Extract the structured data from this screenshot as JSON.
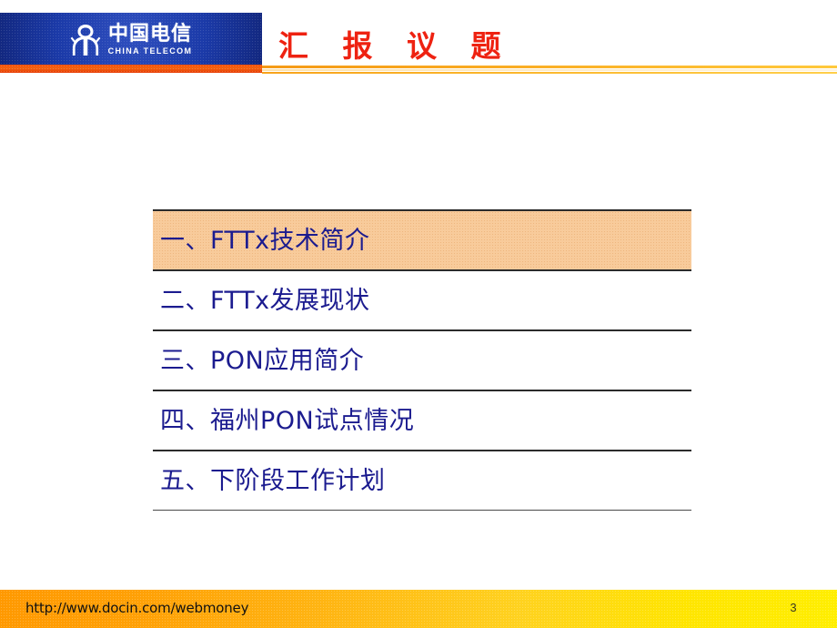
{
  "slide": {
    "background_color": "#ffffff",
    "page_number": "3"
  },
  "header": {
    "logo": {
      "icon_name": "china-telecom-logo-icon",
      "chinese_name": "中国电信",
      "english_name": "CHINA TELECOM",
      "block_color": "#1b3aa8"
    },
    "title": "汇 报 议 题",
    "title_color": "#ee2211",
    "accent_left_color": "#f24f0a",
    "accent_right_color": "#f9ab22"
  },
  "agenda": {
    "items": [
      {
        "label": "一、FTTx技术简介",
        "highlighted": true
      },
      {
        "label": "二、FTTx发展现状",
        "highlighted": false
      },
      {
        "label": "三、PON应用简介",
        "highlighted": false
      },
      {
        "label": "四、福州PON试点情况",
        "highlighted": false
      },
      {
        "label": "五、下阶段工作计划",
        "highlighted": false
      }
    ],
    "text_color": "#1b1b8f",
    "highlight_color": "#f8cb9b",
    "rule_color": "#2b2b2b"
  },
  "footer": {
    "url": "http://www.docin.com/webmoney",
    "page_number": "3",
    "gradient_start": "#ff9900",
    "gradient_end": "#ffee00"
  }
}
